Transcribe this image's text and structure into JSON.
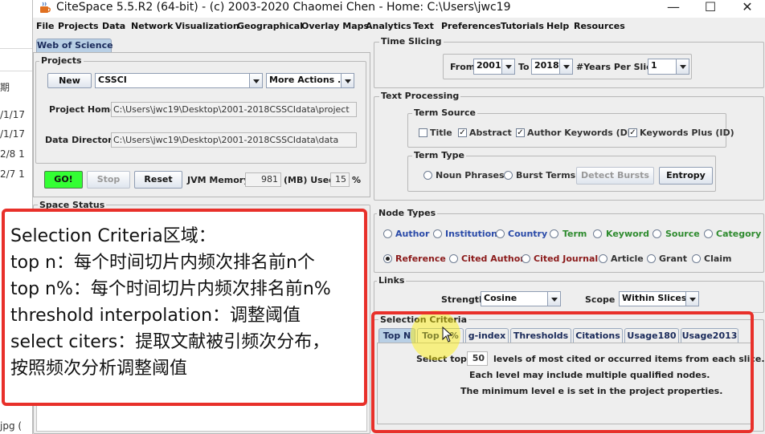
{
  "background_window": {
    "fragments": [
      "期",
      "/1/17 ",
      "/1/17 ",
      "2/8 1",
      "2/7 1",
      "jpg ("
    ]
  },
  "window": {
    "title": "CiteSpace 5.5.R2 (64-bit) - (c) 2003-2020 Chaomei Chen - Home: C:\\Users\\jwc19",
    "minimize": "—",
    "maximize": "☐",
    "close": "✕"
  },
  "menu": [
    "File",
    "Projects",
    "Data",
    "Network",
    "Visualization",
    "Geographical",
    "Overlay Maps",
    "Analytics",
    "Text",
    "Preferences",
    "Tutorials",
    "Help",
    "Resources"
  ],
  "left": {
    "tab": "Web of Science",
    "projects": {
      "label": "Projects",
      "new_button": "New",
      "project_select": "CSSCI",
      "more_actions": "More Actions ...",
      "project_home_label": "Project Home:",
      "project_home_value": "C:\\Users\\jwc19\\Desktop\\2001-2018CSSCIdata\\project",
      "data_directory_label": "Data Directory:",
      "data_directory_value": "C:\\Users\\jwc19\\Desktop\\2001-2018CSSCIdata\\data"
    },
    "controls": {
      "go": "GO!",
      "stop": "Stop",
      "reset": "Reset",
      "jvm_label": "JVM Memory",
      "jvm_value": "981",
      "used_label": "(MB) Used",
      "used_value": "15",
      "percent": "%"
    },
    "space_status": "Space Status"
  },
  "right": {
    "time_slicing": {
      "label": "Time Slicing",
      "from_label": "From",
      "from_value": "2001",
      "to_label": "To",
      "to_value": "2018",
      "years_label": "#Years Per Slice",
      "years_value": "1"
    },
    "text_processing": {
      "label": "Text Processing",
      "term_source": {
        "label": "Term Source",
        "items": [
          {
            "label": "Title",
            "checked": false
          },
          {
            "label": "Abstract",
            "checked": true
          },
          {
            "label": "Author Keywords (DE)",
            "checked": true
          },
          {
            "label": "Keywords Plus (ID)",
            "checked": true
          }
        ]
      },
      "term_type": {
        "label": "Term Type",
        "noun_phrases": "Noun Phrases",
        "burst_terms": "Burst Terms",
        "detect_bursts": "Detect Bursts",
        "entropy": "Entropy"
      }
    },
    "node_types": {
      "label": "Node Types",
      "row1": [
        "Author",
        "Institution",
        "Country",
        "Term",
        "Keyword",
        "Source",
        "Category"
      ],
      "row2": [
        "Reference",
        "Cited Author",
        "Cited Journal",
        "Article",
        "Grant",
        "Claim"
      ],
      "selected": "Reference"
    },
    "links": {
      "label": "Links",
      "strength_label": "Strength",
      "strength_value": "Cosine",
      "scope_label": "Scope",
      "scope_value": "Within Slices"
    },
    "selection_criteria": {
      "label": "Selection Criteria",
      "tabs": [
        "Top N",
        "Top N%",
        "g-index",
        "Thresholds",
        "Citations",
        "Usage180",
        "Usage2013"
      ],
      "active_tab": "Top N",
      "select_top_label": "Select top",
      "select_top_value": "50",
      "select_top_suffix": "levels of most cited or occurred items from each slice.",
      "line2": "Each level may include multiple qualified nodes.",
      "line3": "The minimum level e is set in the project properties."
    }
  },
  "annotation": {
    "lines": [
      "Selection Criteria区域：",
      "top n：每个时间切片内频次排名前n个",
      "top n%：每个时间切片内频次排名前n%",
      "threshold interpolation：调整阈值",
      "select citers：提取文献被引频次分布，",
      "按照频次分析调整阈值"
    ]
  },
  "colors": {
    "annotation_border": "#e8302a",
    "go_button": "#33ff33",
    "active_tab": "#b8cfe5",
    "node_type_label": "#2a4aa8",
    "cursor_highlight": "#fff000"
  }
}
